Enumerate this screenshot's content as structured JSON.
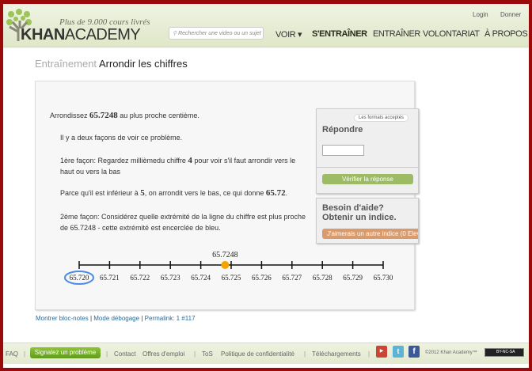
{
  "header": {
    "tagline": "Plus de 9.000 cours livrés",
    "logo_bold": "KHAN",
    "logo_light": "ACADEMY",
    "search_placeholder": "Rechercher une video ou un sujet",
    "nav": [
      "VOIR ▾",
      "S'ENTRAÎNER",
      "ENTRAÎNER",
      "VOLONTARIAT",
      "À PROPOS"
    ],
    "login": "Login",
    "donate": "Donner"
  },
  "breadcrumb": {
    "parent": "Entraînement",
    "current": "Arrondir les chiffres"
  },
  "question": {
    "pre": "Arrondissez ",
    "num": "65.7248",
    "post": " au plus proche centième."
  },
  "hints": {
    "h1": "Il y a deux façons de voir ce problème.",
    "h2_pre": "1ère façon: Regardez millièmedu chiffre ",
    "h2_num": "4",
    "h2_post": " pour voir s'il faut arrondir vers le haut ou vers la bas",
    "h3_pre": "Parce qu'il est inférieur à ",
    "h3_num": "5",
    "h3_mid": ", on arrondit vers le bas, ce qui donne ",
    "h3_ans": "65.72",
    "h3_end": ".",
    "h4": "2ème façon: Considérez quelle extrémité de la ligne du chiffre est plus proche de 65.7248 - cette extrémité est encerclée de bleu."
  },
  "number_line": {
    "ticks": [
      "65.720",
      "65.721",
      "65.722",
      "65.723",
      "65.724",
      "65.725",
      "65.726",
      "65.727",
      "65.728",
      "65.729",
      "65.730"
    ],
    "point": 65.7248,
    "point_label": "65.7248",
    "circled": "65.720",
    "point_color": "#f5a300",
    "circle_color": "#4a8ae8"
  },
  "answer": {
    "formats": "Les formats acceptés",
    "title": "Répondre",
    "input_value": "",
    "check": "Vérifier la réponse"
  },
  "hint_box": {
    "title1": "Besoin d'aide?",
    "title2": "Obtenir un indice.",
    "button": "J'aimerais un autre indice (0 Elevé"
  },
  "links": {
    "scratch": "Montrer bloc-notes",
    "debug": "Mode débogage",
    "permalink": "Permalink: 1 #117"
  },
  "footer": {
    "faq": "FAQ",
    "report": "Signalez un problème",
    "contact": "Contact",
    "jobs": "Offres d'emploi",
    "tos": "ToS",
    "privacy": "Politique de confidentialité",
    "downloads": "Téléchargements",
    "copyright": "©2012 Khan Academy™",
    "license": "BY-NC-SA"
  }
}
